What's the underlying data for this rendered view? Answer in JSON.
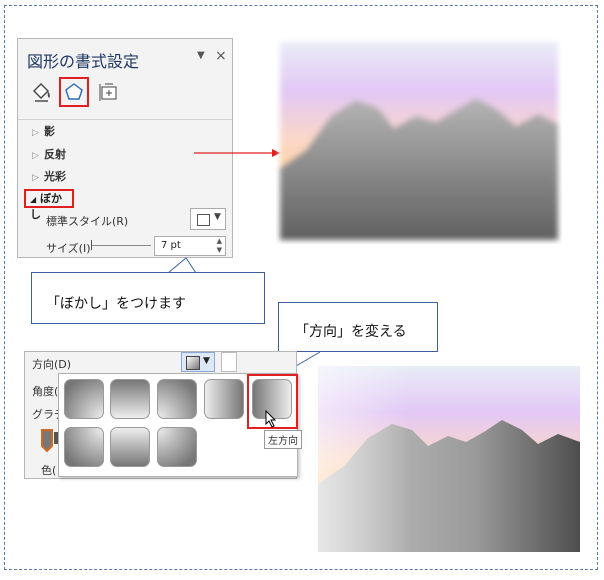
{
  "pane": {
    "title": "図形の書式設定",
    "menu_icon": "▼",
    "close_icon": "×",
    "tabs": [
      {
        "name": "fill-line-tab",
        "icon": "paint-bucket-icon"
      },
      {
        "name": "effects-tab",
        "icon": "pentagon-icon",
        "selected": true
      },
      {
        "name": "size-properties-tab",
        "icon": "layout-icon"
      }
    ],
    "sections": {
      "shadow": "影",
      "reflection": "反射",
      "glow": "光彩",
      "soft_edges": "ぼかし"
    },
    "preset_label": "標準スタイル(R)",
    "size_label": "サイズ(I)",
    "size_value": "7 pt"
  },
  "callouts": {
    "blur": "「ぼかし」をつけます",
    "direction": "「方向」を変える"
  },
  "direction_panel": {
    "direction_label": "方向(D)",
    "angle_label_cut": "角度(",
    "gradient_label_cut": "グラデ",
    "color_label_cut": "色(",
    "tooltip": "左方向"
  },
  "colors": {
    "accent_red": "#e02020",
    "callout_border": "#3d5fa0",
    "title_blue": "#1f3864"
  }
}
